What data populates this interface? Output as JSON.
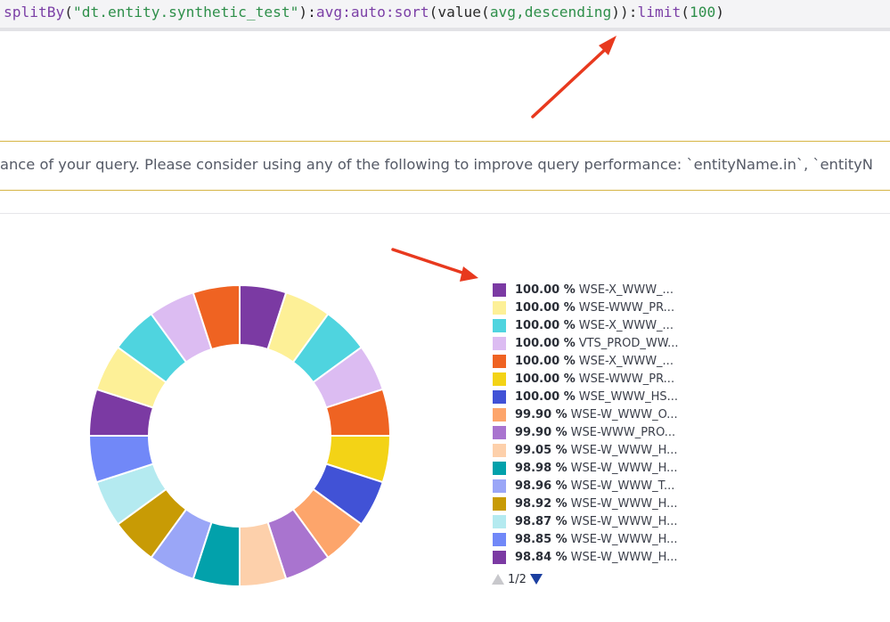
{
  "query": {
    "tokens": [
      {
        "t": "splitBy",
        "c": "fn"
      },
      {
        "t": "(",
        "c": "p"
      },
      {
        "t": "\"dt.entity.synthetic_test\"",
        "c": "str"
      },
      {
        "t": "):",
        "c": "p"
      },
      {
        "t": "avg:auto:sort",
        "c": "fn"
      },
      {
        "t": "(value(",
        "c": "p"
      },
      {
        "t": "avg,descending",
        "c": "str"
      },
      {
        "t": ")):",
        "c": "p"
      },
      {
        "t": "limit",
        "c": "fn"
      },
      {
        "t": "(",
        "c": "p"
      },
      {
        "t": "100",
        "c": "num"
      },
      {
        "t": ")",
        "c": "p"
      }
    ]
  },
  "warning": {
    "text": "ance of your query. Please consider using any of the following to improve query performance: `entityName.in`, `entityN"
  },
  "legend": {
    "items": [
      {
        "value": "100.00 %",
        "name": "WSE-X_WWW_...",
        "color": "#7b3aa3"
      },
      {
        "value": "100.00 %",
        "name": "WSE-WWW_PR...",
        "color": "#fdf097"
      },
      {
        "value": "100.00 %",
        "name": "WSE-X_WWW_...",
        "color": "#4fd4df"
      },
      {
        "value": "100.00 %",
        "name": "VTS_PROD_WW...",
        "color": "#dcbcf2"
      },
      {
        "value": "100.00 %",
        "name": "WSE-X_WWW_...",
        "color": "#ef6322"
      },
      {
        "value": "100.00 %",
        "name": "WSE-WWW_PR...",
        "color": "#f3d316"
      },
      {
        "value": "100.00 %",
        "name": "WSE_WWW_HS...",
        "color": "#4152d6"
      },
      {
        "value": "99.90 %",
        "name": "WSE-W_WWW_O...",
        "color": "#fda56b"
      },
      {
        "value": "99.90 %",
        "name": "WSE-WWW_PRO...",
        "color": "#a974cf"
      },
      {
        "value": "99.05 %",
        "name": "WSE-W_WWW_H...",
        "color": "#fdd0ab"
      },
      {
        "value": "98.98 %",
        "name": "WSE-W_WWW_H...",
        "color": "#02a1ab"
      },
      {
        "value": "98.96 %",
        "name": "WSE-W_WWW_T...",
        "color": "#9aa6f7"
      },
      {
        "value": "98.92 %",
        "name": "WSE-W_WWW_H...",
        "color": "#c89b05"
      },
      {
        "value": "98.87 %",
        "name": "WSE-W_WWW_H...",
        "color": "#b4eaf0"
      },
      {
        "value": "98.85 %",
        "name": "WSE-W_WWW_H...",
        "color": "#7188f8"
      },
      {
        "value": "98.84 %",
        "name": "WSE-W_WWW_H...",
        "color": "#7b3aa3"
      }
    ]
  },
  "pager": {
    "label": "1/2"
  },
  "chart_data": {
    "type": "pie",
    "slices": [
      {
        "color": "#7b3aa3",
        "value": 1
      },
      {
        "color": "#fdf097",
        "value": 1
      },
      {
        "color": "#4fd4df",
        "value": 1
      },
      {
        "color": "#dcbcf2",
        "value": 1
      },
      {
        "color": "#ef6322",
        "value": 1
      },
      {
        "color": "#f3d316",
        "value": 1
      },
      {
        "color": "#4152d6",
        "value": 1
      },
      {
        "color": "#fda56b",
        "value": 1
      },
      {
        "color": "#a974cf",
        "value": 1
      },
      {
        "color": "#fdd0ab",
        "value": 1
      },
      {
        "color": "#02a1ab",
        "value": 1
      },
      {
        "color": "#9aa6f7",
        "value": 1
      },
      {
        "color": "#c89b05",
        "value": 1
      },
      {
        "color": "#b4eaf0",
        "value": 1
      },
      {
        "color": "#7188f8",
        "value": 1
      },
      {
        "color": "#7b3aa3",
        "value": 1
      },
      {
        "color": "#fdf097",
        "value": 1
      },
      {
        "color": "#4fd4df",
        "value": 1
      },
      {
        "color": "#dcbcf2",
        "value": 1
      },
      {
        "color": "#ef6322",
        "value": 1
      }
    ]
  },
  "colors": {
    "arrow": "#e8391e",
    "pager_active": "#1b3fa0",
    "pager_inactive": "#c8c8cc",
    "warning_border": "#d6b545"
  }
}
